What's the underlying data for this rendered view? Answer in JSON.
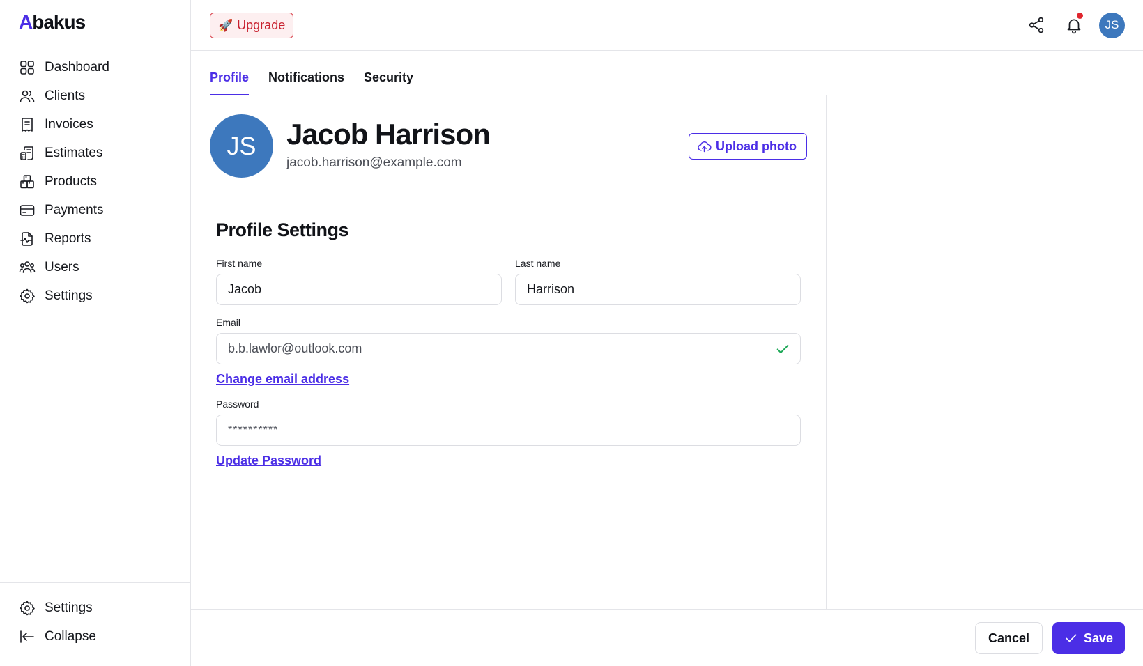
{
  "app": {
    "logo_first": "A",
    "logo_rest": "bakus"
  },
  "sidebar": {
    "items": [
      {
        "label": "Dashboard",
        "icon": "dashboard-icon"
      },
      {
        "label": "Clients",
        "icon": "clients-icon"
      },
      {
        "label": "Invoices",
        "icon": "invoice-icon"
      },
      {
        "label": "Estimates",
        "icon": "estimate-icon"
      },
      {
        "label": "Products",
        "icon": "products-icon"
      },
      {
        "label": "Payments",
        "icon": "card-icon"
      },
      {
        "label": "Reports",
        "icon": "reports-icon"
      },
      {
        "label": "Users",
        "icon": "users-icon"
      },
      {
        "label": "Settings",
        "icon": "gear-icon"
      }
    ],
    "bottom": [
      {
        "label": "Settings",
        "icon": "gear-icon"
      },
      {
        "label": "Collapse",
        "icon": "collapse-icon"
      }
    ]
  },
  "topbar": {
    "upgrade_label": "Upgrade",
    "upgrade_emoji": "🚀",
    "avatar_initials": "JS",
    "has_notification": true
  },
  "tabs": [
    {
      "label": "Profile",
      "active": true
    },
    {
      "label": "Notifications",
      "active": false
    },
    {
      "label": "Security",
      "active": false
    }
  ],
  "profile": {
    "initials": "JS",
    "name": "Jacob Harrison",
    "email": "jacob.harrison@example.com",
    "upload_label": "Upload photo"
  },
  "settings": {
    "title": "Profile Settings",
    "first_name_label": "First name",
    "first_name": "Jacob",
    "last_name_label": "Last name",
    "last_name": "Harrison",
    "email_label": "Email",
    "email": "b.b.lawlor@outlook.com",
    "email_verified": true,
    "change_email_label": "Change email address",
    "password_label": "Password",
    "password_masked": "**********",
    "update_password_label": "Update Password"
  },
  "footer": {
    "cancel_label": "Cancel",
    "save_label": "Save"
  },
  "colors": {
    "accent": "#4b2ee6",
    "avatar": "#3d78bd",
    "upgrade": "#c8202e",
    "success": "#1ea857",
    "notification": "#e0262e"
  }
}
